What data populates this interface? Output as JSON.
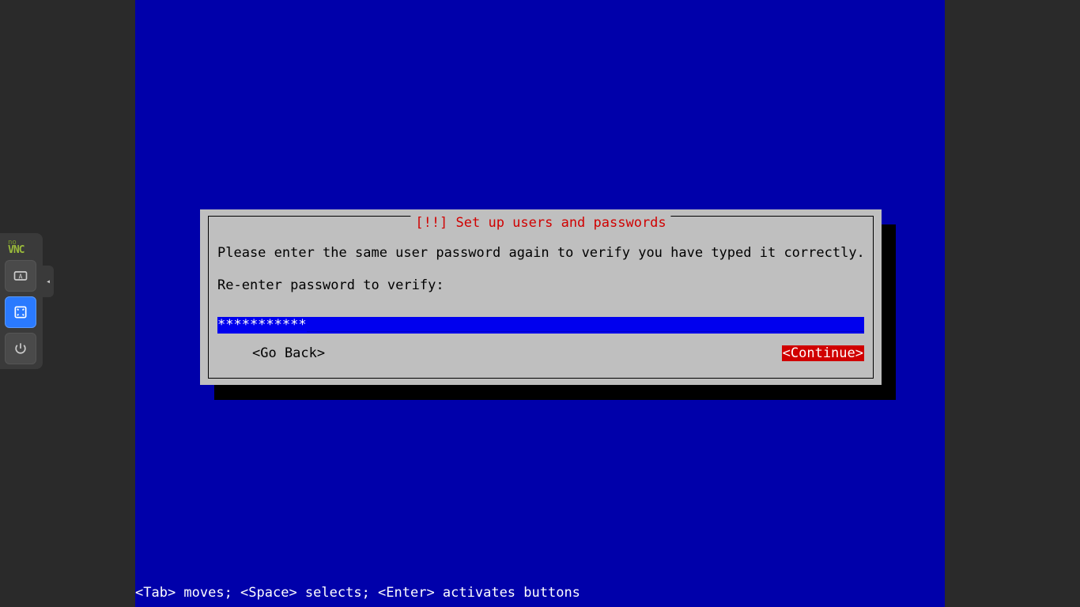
{
  "novnc": {
    "logo_top": "no",
    "logo_bot": "VNC",
    "expand_glyph": "◂"
  },
  "dialog": {
    "title_prefix": "[!!] ",
    "title": "Set up users and passwords",
    "instruction": "Please enter the same user password again to verify you have typed it correctly.",
    "prompt": "Re-enter password to verify:",
    "password_masked": "***********",
    "password_fill": "_______________________________________________________________________________________",
    "go_back_label": "<Go Back>",
    "continue_label": "<Continue>"
  },
  "statusbar": "<Tab> moves; <Space> selects; <Enter> activates buttons"
}
